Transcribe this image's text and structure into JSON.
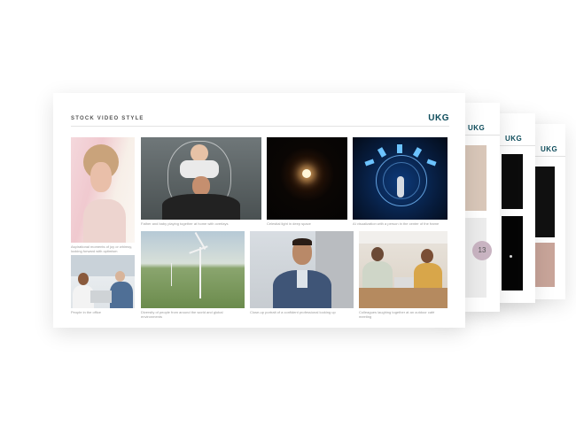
{
  "document": {
    "title": "STOCK VIDEO STYLE",
    "logo": "UKG"
  },
  "back_pages": {
    "logo": "UKG",
    "badge": "13"
  },
  "tiles": [
    {
      "caption": "Aspirational moments of joy or whimsy, looking forward with optimism"
    },
    {
      "caption": "Father and baby playing together at home with overlays"
    },
    {
      "caption": "Celestial light in deep space"
    },
    {
      "caption": "AI visualization with a person in the center of the frame"
    },
    {
      "caption": "People in the office"
    },
    {
      "caption": "Diversity of people from around the world and global environments"
    },
    {
      "caption": "Close-up portrait of a confident professional looking up"
    },
    {
      "caption": "Colleagues laughing together at an outdoor café meeting"
    }
  ]
}
